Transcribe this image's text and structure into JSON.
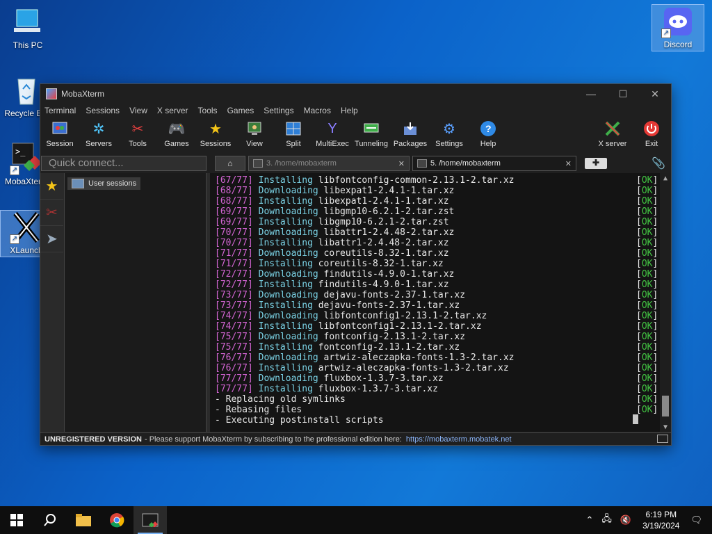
{
  "desktop": {
    "icons": [
      {
        "label": "This PC"
      },
      {
        "label": "Recycle Bin"
      },
      {
        "label": "MobaXterm"
      },
      {
        "label": "XLaunch"
      },
      {
        "label": "Discord"
      }
    ]
  },
  "window": {
    "title": "MobaXterm",
    "menu": [
      "Terminal",
      "Sessions",
      "View",
      "X server",
      "Tools",
      "Games",
      "Settings",
      "Macros",
      "Help"
    ],
    "toolbar": [
      {
        "label": "Session",
        "icon": "session-icon"
      },
      {
        "label": "Servers",
        "icon": "servers-icon"
      },
      {
        "label": "Tools",
        "icon": "tools-icon"
      },
      {
        "label": "Games",
        "icon": "gamepad-icon"
      },
      {
        "label": "Sessions",
        "icon": "star-icon"
      },
      {
        "label": "View",
        "icon": "view-icon"
      },
      {
        "label": "Split",
        "icon": "split-icon"
      },
      {
        "label": "MultiExec",
        "icon": "multiexec-icon"
      },
      {
        "label": "Tunneling",
        "icon": "tunneling-icon"
      },
      {
        "label": "Packages",
        "icon": "packages-icon"
      },
      {
        "label": "Settings",
        "icon": "gears-icon"
      },
      {
        "label": "Help",
        "icon": "help-icon"
      }
    ],
    "toolbar_right": [
      {
        "label": "X server",
        "icon": "xserver-icon"
      },
      {
        "label": "Exit",
        "icon": "power-icon"
      }
    ],
    "quick_connect_placeholder": "Quick connect...",
    "tabs": [
      {
        "label": "3. /home/mobaxterm",
        "active": false
      },
      {
        "label": "5. /home/mobaxterm",
        "active": true
      }
    ],
    "sessions_panel": {
      "item": "User sessions"
    },
    "terminal": {
      "lines": [
        {
          "num": "[67/77]",
          "verb": "Installing",
          "pkg": "libfontconfig-common-2.13.1-2.tar.xz",
          "ok": "OK"
        },
        {
          "num": "[68/77]",
          "verb": "Downloading",
          "pkg": "libexpat1-2.4.1-1.tar.xz",
          "ok": "OK"
        },
        {
          "num": "[68/77]",
          "verb": "Installing",
          "pkg": "libexpat1-2.4.1-1.tar.xz",
          "ok": "OK"
        },
        {
          "num": "[69/77]",
          "verb": "Downloading",
          "pkg": "libgmp10-6.2.1-2.tar.zst",
          "ok": "OK"
        },
        {
          "num": "[69/77]",
          "verb": "Installing",
          "pkg": "libgmp10-6.2.1-2.tar.zst",
          "ok": "OK"
        },
        {
          "num": "[70/77]",
          "verb": "Downloading",
          "pkg": "libattr1-2.4.48-2.tar.xz",
          "ok": "OK"
        },
        {
          "num": "[70/77]",
          "verb": "Installing",
          "pkg": "libattr1-2.4.48-2.tar.xz",
          "ok": "OK"
        },
        {
          "num": "[71/77]",
          "verb": "Downloading",
          "pkg": "coreutils-8.32-1.tar.xz",
          "ok": "OK"
        },
        {
          "num": "[71/77]",
          "verb": "Installing",
          "pkg": "coreutils-8.32-1.tar.xz",
          "ok": "OK"
        },
        {
          "num": "[72/77]",
          "verb": "Downloading",
          "pkg": "findutils-4.9.0-1.tar.xz",
          "ok": "OK"
        },
        {
          "num": "[72/77]",
          "verb": "Installing",
          "pkg": "findutils-4.9.0-1.tar.xz",
          "ok": "OK"
        },
        {
          "num": "[73/77]",
          "verb": "Downloading",
          "pkg": "dejavu-fonts-2.37-1.tar.xz",
          "ok": "OK"
        },
        {
          "num": "[73/77]",
          "verb": "Installing",
          "pkg": "dejavu-fonts-2.37-1.tar.xz",
          "ok": "OK"
        },
        {
          "num": "[74/77]",
          "verb": "Downloading",
          "pkg": "libfontconfig1-2.13.1-2.tar.xz",
          "ok": "OK"
        },
        {
          "num": "[74/77]",
          "verb": "Installing",
          "pkg": "libfontconfig1-2.13.1-2.tar.xz",
          "ok": "OK"
        },
        {
          "num": "[75/77]",
          "verb": "Downloading",
          "pkg": "fontconfig-2.13.1-2.tar.xz",
          "ok": "OK"
        },
        {
          "num": "[75/77]",
          "verb": "Installing",
          "pkg": "fontconfig-2.13.1-2.tar.xz",
          "ok": "OK"
        },
        {
          "num": "[76/77]",
          "verb": "Downloading",
          "pkg": "artwiz-aleczapka-fonts-1.3-2.tar.xz",
          "ok": "OK"
        },
        {
          "num": "[76/77]",
          "verb": "Installing",
          "pkg": "artwiz-aleczapka-fonts-1.3-2.tar.xz",
          "ok": "OK"
        },
        {
          "num": "[77/77]",
          "verb": "Downloading",
          "pkg": "fluxbox-1.3.7-3.tar.xz",
          "ok": "OK"
        },
        {
          "num": "[77/77]",
          "verb": "Installing",
          "pkg": "fluxbox-1.3.7-3.tar.xz",
          "ok": "OK"
        },
        {
          "text": "- Replacing old symlinks",
          "ok": "OK"
        },
        {
          "text": "- Rebasing files",
          "ok": "OK"
        },
        {
          "text": "- Executing postinstall scripts",
          "ok": ""
        }
      ]
    },
    "status": {
      "unregistered": "UNREGISTERED VERSION",
      "message": "-  Please support MobaXterm by subscribing to the professional edition here:",
      "link": "https://mobaxterm.mobatek.net"
    }
  },
  "taskbar": {
    "time": "6:19 PM",
    "date": "3/19/2024"
  }
}
